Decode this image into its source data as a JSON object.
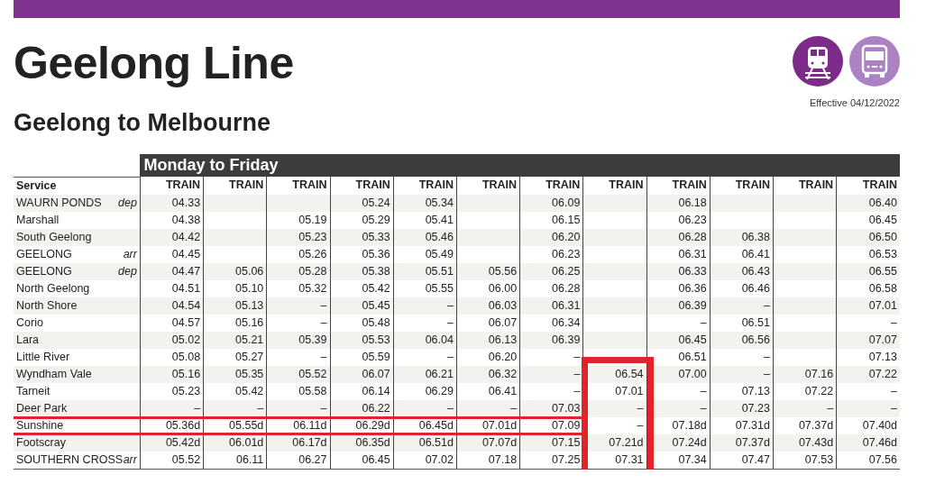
{
  "title": "Geelong Line",
  "effective": "Effective 04/12/2022",
  "section": "Geelong to Melbourne",
  "timetable": {
    "day_header": "Monday to Friday",
    "service_label": "Service",
    "columns": [
      {
        "label": "TRAIN",
        "highlighted": false
      },
      {
        "label": "TRAIN",
        "highlighted": false
      },
      {
        "label": "TRAIN",
        "highlighted": false
      },
      {
        "label": "TRAIN",
        "highlighted": false
      },
      {
        "label": "TRAIN",
        "highlighted": false
      },
      {
        "label": "TRAIN",
        "highlighted": false
      },
      {
        "label": "TRAIN",
        "highlighted": false
      },
      {
        "label": "TRAIN",
        "highlighted": true
      },
      {
        "label": "TRAIN",
        "highlighted": false
      },
      {
        "label": "TRAIN",
        "highlighted": false
      },
      {
        "label": "TRAIN",
        "highlighted": false
      },
      {
        "label": "TRAIN",
        "highlighted": false
      }
    ],
    "rows": [
      {
        "station": "WAURN PONDS",
        "note": "dep",
        "highlighted": false,
        "cells": [
          {
            "kind": "time",
            "text": "04.33"
          },
          {
            "kind": "blank"
          },
          {
            "kind": "blank"
          },
          {
            "kind": "time",
            "text": "05.24"
          },
          {
            "kind": "time",
            "text": "05.34"
          },
          {
            "kind": "blank"
          },
          {
            "kind": "time",
            "text": "06.09"
          },
          {
            "kind": "blank"
          },
          {
            "kind": "time",
            "text": "06.18"
          },
          {
            "kind": "blank"
          },
          {
            "kind": "blank"
          },
          {
            "kind": "time",
            "text": "06.40"
          }
        ]
      },
      {
        "station": "Marshall",
        "highlighted": false,
        "cells": [
          {
            "kind": "time",
            "text": "04.38"
          },
          {
            "kind": "blank"
          },
          {
            "kind": "time",
            "text": "05.19"
          },
          {
            "kind": "time",
            "text": "05.29"
          },
          {
            "kind": "time",
            "text": "05.41"
          },
          {
            "kind": "blank"
          },
          {
            "kind": "time",
            "text": "06.15"
          },
          {
            "kind": "blank"
          },
          {
            "kind": "time",
            "text": "06.23"
          },
          {
            "kind": "blank"
          },
          {
            "kind": "blank"
          },
          {
            "kind": "time",
            "text": "06.45"
          }
        ]
      },
      {
        "station": "South Geelong",
        "highlighted": false,
        "cells": [
          {
            "kind": "time",
            "text": "04.42"
          },
          {
            "kind": "blank"
          },
          {
            "kind": "time",
            "text": "05.23"
          },
          {
            "kind": "time",
            "text": "05.33"
          },
          {
            "kind": "time",
            "text": "05.46"
          },
          {
            "kind": "blank"
          },
          {
            "kind": "time",
            "text": "06.20"
          },
          {
            "kind": "blank"
          },
          {
            "kind": "time",
            "text": "06.28"
          },
          {
            "kind": "time",
            "text": "06.38"
          },
          {
            "kind": "blank"
          },
          {
            "kind": "time",
            "text": "06.50"
          }
        ]
      },
      {
        "station": "GEELONG",
        "note": "arr",
        "highlighted": false,
        "cells": [
          {
            "kind": "time",
            "text": "04.45"
          },
          {
            "kind": "blank"
          },
          {
            "kind": "time",
            "text": "05.26"
          },
          {
            "kind": "time",
            "text": "05.36"
          },
          {
            "kind": "time",
            "text": "05.49"
          },
          {
            "kind": "blank"
          },
          {
            "kind": "time",
            "text": "06.23"
          },
          {
            "kind": "blank"
          },
          {
            "kind": "time",
            "text": "06.31"
          },
          {
            "kind": "time",
            "text": "06.41"
          },
          {
            "kind": "blank"
          },
          {
            "kind": "time",
            "text": "06.53"
          }
        ]
      },
      {
        "station": "GEELONG",
        "note": "dep",
        "highlighted": false,
        "cells": [
          {
            "kind": "time",
            "text": "04.47"
          },
          {
            "kind": "time",
            "text": "05.06"
          },
          {
            "kind": "time",
            "text": "05.28"
          },
          {
            "kind": "time",
            "text": "05.38"
          },
          {
            "kind": "time",
            "text": "05.51"
          },
          {
            "kind": "time",
            "text": "05.56"
          },
          {
            "kind": "time",
            "text": "06.25"
          },
          {
            "kind": "blank"
          },
          {
            "kind": "time",
            "text": "06.33"
          },
          {
            "kind": "time",
            "text": "06.43"
          },
          {
            "kind": "blank"
          },
          {
            "kind": "time",
            "text": "06.55"
          }
        ]
      },
      {
        "station": "North Geelong",
        "highlighted": false,
        "cells": [
          {
            "kind": "time",
            "text": "04.51"
          },
          {
            "kind": "time",
            "text": "05.10"
          },
          {
            "kind": "time",
            "text": "05.32"
          },
          {
            "kind": "time",
            "text": "05.42"
          },
          {
            "kind": "time",
            "text": "05.55"
          },
          {
            "kind": "time",
            "text": "06.00"
          },
          {
            "kind": "time",
            "text": "06.28"
          },
          {
            "kind": "blank"
          },
          {
            "kind": "time",
            "text": "06.36"
          },
          {
            "kind": "time",
            "text": "06.46"
          },
          {
            "kind": "blank"
          },
          {
            "kind": "time",
            "text": "06.58"
          }
        ]
      },
      {
        "station": "North Shore",
        "highlighted": false,
        "cells": [
          {
            "kind": "time",
            "text": "04.54"
          },
          {
            "kind": "time",
            "text": "05.13"
          },
          {
            "kind": "time",
            "text": "–"
          },
          {
            "kind": "time",
            "text": "05.45"
          },
          {
            "kind": "time",
            "text": "–"
          },
          {
            "kind": "time",
            "text": "06.03"
          },
          {
            "kind": "time",
            "text": "06.31"
          },
          {
            "kind": "blank"
          },
          {
            "kind": "time",
            "text": "06.39"
          },
          {
            "kind": "time",
            "text": "–"
          },
          {
            "kind": "blank"
          },
          {
            "kind": "time",
            "text": "07.01"
          }
        ]
      },
      {
        "station": "Corio",
        "highlighted": false,
        "cells": [
          {
            "kind": "time",
            "text": "04.57"
          },
          {
            "kind": "time",
            "text": "05.16"
          },
          {
            "kind": "time",
            "text": "–"
          },
          {
            "kind": "time",
            "text": "05.48"
          },
          {
            "kind": "time",
            "text": "–"
          },
          {
            "kind": "time",
            "text": "06.07"
          },
          {
            "kind": "time",
            "text": "06.34"
          },
          {
            "kind": "blank"
          },
          {
            "kind": "time",
            "text": "–"
          },
          {
            "kind": "time",
            "text": "06.51"
          },
          {
            "kind": "blank"
          },
          {
            "kind": "time",
            "text": "–"
          }
        ]
      },
      {
        "station": "Lara",
        "highlighted": false,
        "cells": [
          {
            "kind": "time",
            "text": "05.02"
          },
          {
            "kind": "time",
            "text": "05.21"
          },
          {
            "kind": "time",
            "text": "05.39"
          },
          {
            "kind": "time",
            "text": "05.53"
          },
          {
            "kind": "time",
            "text": "06.04"
          },
          {
            "kind": "time",
            "text": "06.13"
          },
          {
            "kind": "time",
            "text": "06.39"
          },
          {
            "kind": "blank"
          },
          {
            "kind": "time",
            "text": "06.45"
          },
          {
            "kind": "time",
            "text": "06.56"
          },
          {
            "kind": "blank"
          },
          {
            "kind": "time",
            "text": "07.07"
          }
        ]
      },
      {
        "station": "Little River",
        "highlighted": false,
        "cells": [
          {
            "kind": "time",
            "text": "05.08"
          },
          {
            "kind": "time",
            "text": "05.27"
          },
          {
            "kind": "time",
            "text": "–"
          },
          {
            "kind": "time",
            "text": "05.59"
          },
          {
            "kind": "time",
            "text": "–"
          },
          {
            "kind": "time",
            "text": "06.20"
          },
          {
            "kind": "time",
            "text": "–"
          },
          {
            "kind": "blank"
          },
          {
            "kind": "time",
            "text": "06.51"
          },
          {
            "kind": "time",
            "text": "–"
          },
          {
            "kind": "blank"
          },
          {
            "kind": "time",
            "text": "07.13"
          }
        ]
      },
      {
        "station": "Wyndham Vale",
        "highlighted": false,
        "cells": [
          {
            "kind": "time",
            "text": "05.16"
          },
          {
            "kind": "time",
            "text": "05.35"
          },
          {
            "kind": "time",
            "text": "05.52"
          },
          {
            "kind": "time",
            "text": "06.07"
          },
          {
            "kind": "time",
            "text": "06.21"
          },
          {
            "kind": "time",
            "text": "06.32"
          },
          {
            "kind": "time",
            "text": "–"
          },
          {
            "kind": "time",
            "text": "06.54"
          },
          {
            "kind": "time",
            "text": "07.00"
          },
          {
            "kind": "time",
            "text": "–"
          },
          {
            "kind": "time",
            "text": "07.16"
          },
          {
            "kind": "time",
            "text": "07.22"
          }
        ]
      },
      {
        "station": "Tarneit",
        "highlighted": false,
        "cells": [
          {
            "kind": "time",
            "text": "05.23"
          },
          {
            "kind": "time",
            "text": "05.42"
          },
          {
            "kind": "time",
            "text": "05.58"
          },
          {
            "kind": "time",
            "text": "06.14"
          },
          {
            "kind": "time",
            "text": "06.29"
          },
          {
            "kind": "time",
            "text": "06.41"
          },
          {
            "kind": "time",
            "text": "–"
          },
          {
            "kind": "time",
            "text": "07.01"
          },
          {
            "kind": "time",
            "text": "–"
          },
          {
            "kind": "time",
            "text": "07.13"
          },
          {
            "kind": "time",
            "text": "07.22"
          },
          {
            "kind": "time",
            "text": "–"
          }
        ]
      },
      {
        "station": "Deer Park",
        "highlighted": false,
        "cells": [
          {
            "kind": "time",
            "text": "–"
          },
          {
            "kind": "time",
            "text": "–"
          },
          {
            "kind": "time",
            "text": "–"
          },
          {
            "kind": "time",
            "text": "06.22"
          },
          {
            "kind": "time",
            "text": "–"
          },
          {
            "kind": "time",
            "text": "–"
          },
          {
            "kind": "time",
            "text": "07.03"
          },
          {
            "kind": "time",
            "text": "–"
          },
          {
            "kind": "time",
            "text": "–"
          },
          {
            "kind": "time",
            "text": "07.23"
          },
          {
            "kind": "time",
            "text": "–"
          },
          {
            "kind": "time",
            "text": "–"
          }
        ]
      },
      {
        "station": "Sunshine",
        "highlighted": true,
        "cells": [
          {
            "kind": "time",
            "text": "05.36d"
          },
          {
            "kind": "time",
            "text": "05.55d"
          },
          {
            "kind": "time",
            "text": "06.11d"
          },
          {
            "kind": "time",
            "text": "06.29d"
          },
          {
            "kind": "time",
            "text": "06.45d"
          },
          {
            "kind": "time",
            "text": "07.01d"
          },
          {
            "kind": "time",
            "text": "07.09"
          },
          {
            "kind": "time",
            "text": "–"
          },
          {
            "kind": "time",
            "text": "07.18d"
          },
          {
            "kind": "time",
            "text": "07.31d"
          },
          {
            "kind": "time",
            "text": "07.37d"
          },
          {
            "kind": "time",
            "text": "07.40d"
          }
        ]
      },
      {
        "station": "Footscray",
        "highlighted": false,
        "cells": [
          {
            "kind": "time",
            "text": "05.42d"
          },
          {
            "kind": "time",
            "text": "06.01d"
          },
          {
            "kind": "time",
            "text": "06.17d"
          },
          {
            "kind": "time",
            "text": "06.35d"
          },
          {
            "kind": "time",
            "text": "06.51d"
          },
          {
            "kind": "time",
            "text": "07.07d"
          },
          {
            "kind": "time",
            "text": "07.15"
          },
          {
            "kind": "time",
            "text": "07.21d"
          },
          {
            "kind": "time",
            "text": "07.24d"
          },
          {
            "kind": "time",
            "text": "07.37d"
          },
          {
            "kind": "time",
            "text": "07.43d"
          },
          {
            "kind": "time",
            "text": "07.46d"
          }
        ]
      },
      {
        "station": "SOUTHERN CROSS",
        "note": "arr",
        "highlighted": false,
        "cells": [
          {
            "kind": "time",
            "text": "05.52"
          },
          {
            "kind": "time",
            "text": "06.11"
          },
          {
            "kind": "time",
            "text": "06.27"
          },
          {
            "kind": "time",
            "text": "06.45"
          },
          {
            "kind": "time",
            "text": "07.02"
          },
          {
            "kind": "time",
            "text": "07.18"
          },
          {
            "kind": "time",
            "text": "07.25"
          },
          {
            "kind": "time",
            "text": "07.31"
          },
          {
            "kind": "time",
            "text": "07.34"
          },
          {
            "kind": "time",
            "text": "07.47"
          },
          {
            "kind": "time",
            "text": "07.53"
          },
          {
            "kind": "time",
            "text": "07.56"
          }
        ]
      }
    ]
  }
}
